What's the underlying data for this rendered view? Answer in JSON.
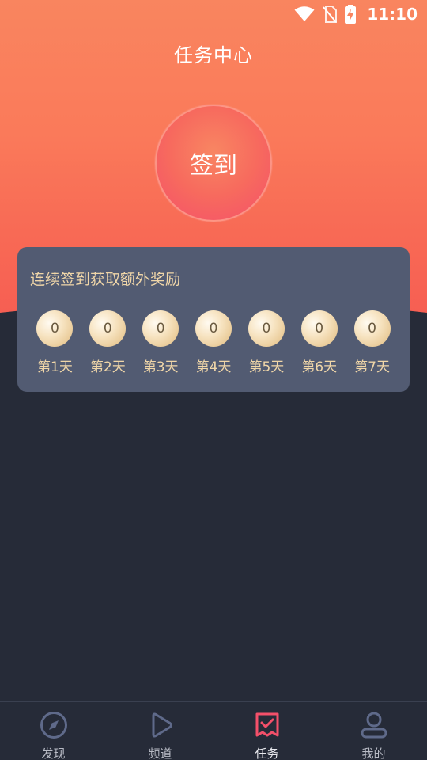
{
  "status_bar": {
    "time": "11:10",
    "icons": [
      "wifi-icon",
      "no-sim-icon",
      "battery-charging-icon"
    ]
  },
  "header": {
    "title": "任务中心"
  },
  "signin": {
    "label": "签到"
  },
  "streak_card": {
    "title": "连续签到获取额外奖励",
    "days": [
      {
        "value": "0",
        "label": "第1天"
      },
      {
        "value": "0",
        "label": "第2天"
      },
      {
        "value": "0",
        "label": "第3天"
      },
      {
        "value": "0",
        "label": "第4天"
      },
      {
        "value": "0",
        "label": "第5天"
      },
      {
        "value": "0",
        "label": "第6天"
      },
      {
        "value": "0",
        "label": "第7天"
      }
    ]
  },
  "bottom_nav": {
    "items": [
      {
        "label": "发现",
        "icon": "compass-icon",
        "active": false
      },
      {
        "label": "频道",
        "icon": "play-icon",
        "active": false
      },
      {
        "label": "任务",
        "icon": "task-check-icon",
        "active": true
      },
      {
        "label": "我的",
        "icon": "user-icon",
        "active": false
      }
    ]
  },
  "colors": {
    "hero_top": "#f9855f",
    "hero_bottom": "#f65c52",
    "background": "#262b38",
    "card": "#525b72",
    "gold_text": "#f0d6a8",
    "active_accent": "#f4506a",
    "nav_inactive": "#5f6a8a"
  }
}
